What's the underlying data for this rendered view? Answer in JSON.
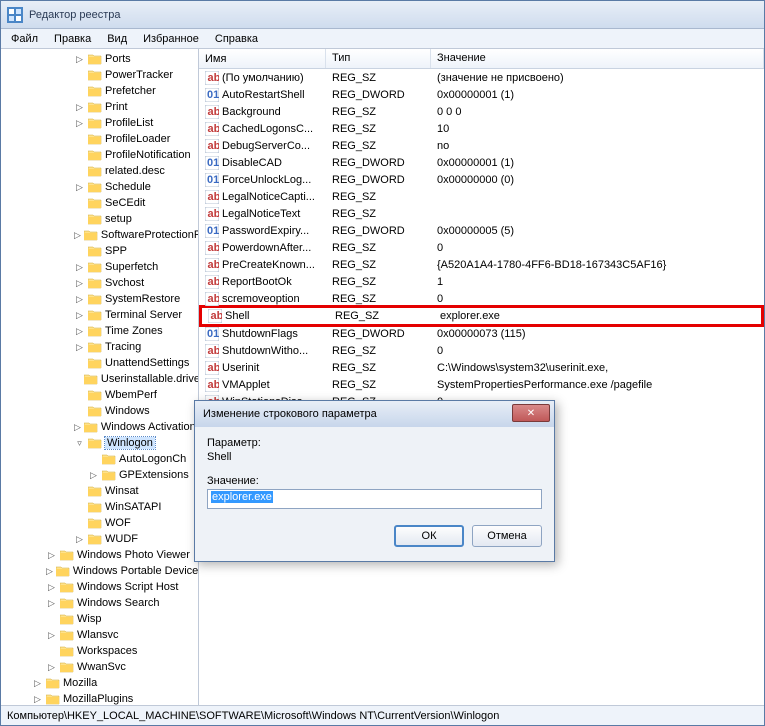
{
  "window": {
    "title": "Редактор реестра"
  },
  "menu": {
    "file": "Файл",
    "edit": "Правка",
    "view": "Вид",
    "favorites": "Избранное",
    "help": "Справка"
  },
  "tree": {
    "items": [
      {
        "indent": 5,
        "toggle": "▷",
        "label": "Ports"
      },
      {
        "indent": 5,
        "toggle": "",
        "label": "PowerTracker"
      },
      {
        "indent": 5,
        "toggle": "",
        "label": "Prefetcher"
      },
      {
        "indent": 5,
        "toggle": "▷",
        "label": "Print"
      },
      {
        "indent": 5,
        "toggle": "▷",
        "label": "ProfileList"
      },
      {
        "indent": 5,
        "toggle": "",
        "label": "ProfileLoader"
      },
      {
        "indent": 5,
        "toggle": "",
        "label": "ProfileNotification"
      },
      {
        "indent": 5,
        "toggle": "",
        "label": "related.desc"
      },
      {
        "indent": 5,
        "toggle": "▷",
        "label": "Schedule"
      },
      {
        "indent": 5,
        "toggle": "",
        "label": "SeCEdit"
      },
      {
        "indent": 5,
        "toggle": "",
        "label": "setup"
      },
      {
        "indent": 5,
        "toggle": "▷",
        "label": "SoftwareProtectionPlatform"
      },
      {
        "indent": 5,
        "toggle": "",
        "label": "SPP"
      },
      {
        "indent": 5,
        "toggle": "▷",
        "label": "Superfetch"
      },
      {
        "indent": 5,
        "toggle": "▷",
        "label": "Svchost"
      },
      {
        "indent": 5,
        "toggle": "▷",
        "label": "SystemRestore"
      },
      {
        "indent": 5,
        "toggle": "▷",
        "label": "Terminal Server"
      },
      {
        "indent": 5,
        "toggle": "▷",
        "label": "Time Zones"
      },
      {
        "indent": 5,
        "toggle": "▷",
        "label": "Tracing"
      },
      {
        "indent": 5,
        "toggle": "",
        "label": "UnattendSettings"
      },
      {
        "indent": 5,
        "toggle": "",
        "label": "Userinstallable.drivers"
      },
      {
        "indent": 5,
        "toggle": "",
        "label": "WbemPerf"
      },
      {
        "indent": 5,
        "toggle": "",
        "label": "Windows"
      },
      {
        "indent": 5,
        "toggle": "▷",
        "label": "Windows Activation"
      },
      {
        "indent": 5,
        "toggle": "▿",
        "label": "Winlogon",
        "selected": true
      },
      {
        "indent": 6,
        "toggle": "",
        "label": "AutoLogonCh"
      },
      {
        "indent": 6,
        "toggle": "▷",
        "label": "GPExtensions"
      },
      {
        "indent": 5,
        "toggle": "",
        "label": "Winsat"
      },
      {
        "indent": 5,
        "toggle": "",
        "label": "WinSATAPI"
      },
      {
        "indent": 5,
        "toggle": "",
        "label": "WOF"
      },
      {
        "indent": 5,
        "toggle": "▷",
        "label": "WUDF"
      },
      {
        "indent": 3,
        "toggle": "▷",
        "label": "Windows Photo Viewer"
      },
      {
        "indent": 3,
        "toggle": "▷",
        "label": "Windows Portable Devices"
      },
      {
        "indent": 3,
        "toggle": "▷",
        "label": "Windows Script Host"
      },
      {
        "indent": 3,
        "toggle": "▷",
        "label": "Windows Search"
      },
      {
        "indent": 3,
        "toggle": "",
        "label": "Wisp"
      },
      {
        "indent": 3,
        "toggle": "▷",
        "label": "Wlansvc"
      },
      {
        "indent": 3,
        "toggle": "",
        "label": "Workspaces"
      },
      {
        "indent": 3,
        "toggle": "▷",
        "label": "WwanSvc"
      },
      {
        "indent": 2,
        "toggle": "▷",
        "label": "Mozilla"
      },
      {
        "indent": 2,
        "toggle": "▷",
        "label": "MozillaPlugins"
      }
    ]
  },
  "columns": {
    "name": "Имя",
    "type": "Тип",
    "data": "Значение"
  },
  "values": [
    {
      "k": "s",
      "name": "(По умолчанию)",
      "type": "REG_SZ",
      "data": "(значение не присвоено)"
    },
    {
      "k": "d",
      "name": "AutoRestartShell",
      "type": "REG_DWORD",
      "data": "0x00000001 (1)"
    },
    {
      "k": "s",
      "name": "Background",
      "type": "REG_SZ",
      "data": "0 0 0"
    },
    {
      "k": "s",
      "name": "CachedLogonsC...",
      "type": "REG_SZ",
      "data": "10"
    },
    {
      "k": "s",
      "name": "DebugServerCo...",
      "type": "REG_SZ",
      "data": "no"
    },
    {
      "k": "d",
      "name": "DisableCAD",
      "type": "REG_DWORD",
      "data": "0x00000001 (1)"
    },
    {
      "k": "d",
      "name": "ForceUnlockLog...",
      "type": "REG_DWORD",
      "data": "0x00000000 (0)"
    },
    {
      "k": "s",
      "name": "LegalNoticeCapti...",
      "type": "REG_SZ",
      "data": ""
    },
    {
      "k": "s",
      "name": "LegalNoticeText",
      "type": "REG_SZ",
      "data": ""
    },
    {
      "k": "d",
      "name": "PasswordExpiry...",
      "type": "REG_DWORD",
      "data": "0x00000005 (5)"
    },
    {
      "k": "s",
      "name": "PowerdownAfter...",
      "type": "REG_SZ",
      "data": "0"
    },
    {
      "k": "s",
      "name": "PreCreateKnown...",
      "type": "REG_SZ",
      "data": "{A520A1A4-1780-4FF6-BD18-167343C5AF16}"
    },
    {
      "k": "s",
      "name": "ReportBootOk",
      "type": "REG_SZ",
      "data": "1"
    },
    {
      "k": "s",
      "name": "scremoveoption",
      "type": "REG_SZ",
      "data": "0"
    },
    {
      "k": "s",
      "name": "Shell",
      "type": "REG_SZ",
      "data": "explorer.exe",
      "hl": true
    },
    {
      "k": "d",
      "name": "ShutdownFlags",
      "type": "REG_DWORD",
      "data": "0x00000073 (115)"
    },
    {
      "k": "s",
      "name": "ShutdownWitho...",
      "type": "REG_SZ",
      "data": "0"
    },
    {
      "k": "s",
      "name": "Userinit",
      "type": "REG_SZ",
      "data": "C:\\Windows\\system32\\userinit.exe,"
    },
    {
      "k": "s",
      "name": "VMApplet",
      "type": "REG_SZ",
      "data": "SystemPropertiesPerformance.exe /pagefile"
    },
    {
      "k": "s",
      "name": "WinStationsDisa...",
      "type": "REG_SZ",
      "data": "0"
    }
  ],
  "statusbar": "Компьютер\\HKEY_LOCAL_MACHINE\\SOFTWARE\\Microsoft\\Windows NT\\CurrentVersion\\Winlogon",
  "dialog": {
    "title": "Изменение строкового параметра",
    "param_label": "Параметр:",
    "param_value": "Shell",
    "value_label": "Значение:",
    "value_text": "explorer.exe",
    "ok": "ОК",
    "cancel": "Отмена"
  }
}
